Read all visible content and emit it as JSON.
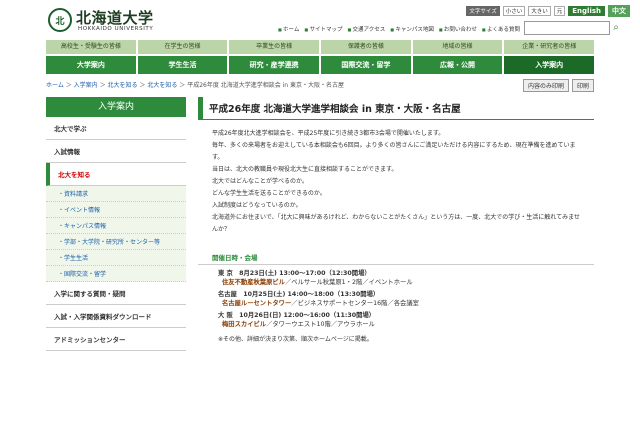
{
  "header": {
    "logo_mark": "北",
    "logo_ja": "北海道大学",
    "logo_en": "HOKKAIDO UNIVERSITY",
    "text_size_label": "文字サイズ",
    "sizes": [
      "小さい",
      "大きい",
      "元"
    ],
    "lang_en": "English",
    "lang_zh": "中文",
    "util_links": [
      "ホーム",
      "サイトマップ",
      "交通アクセス",
      "キャンパス地図",
      "お問い合わせ",
      "よくある質問"
    ],
    "search_placeholder": ""
  },
  "audience_tabs": [
    "高校生・受験生の皆様",
    "在学生の皆様",
    "卒業生の皆様",
    "保護者の皆様",
    "地域の皆様",
    "企業・研究者の皆様"
  ],
  "main_nav": [
    "大学案内",
    "学生生活",
    "研究・産学連携",
    "国際交流・留学",
    "広報・公開",
    "入学案内"
  ],
  "breadcrumb": [
    "ホーム",
    "入学案内",
    "北大を知る",
    "北大を知る",
    "平成26年度 北海道大学進学相談会 in 東京・大阪・名古屋"
  ],
  "print_buttons": [
    "内容のみ印刷",
    "印刷"
  ],
  "sidebar": {
    "head": "入学案内",
    "items": [
      "北大で学ぶ",
      "入試情報",
      "北大を知る"
    ],
    "subs": [
      "資料請求",
      "イベント情報",
      "キャンパス情報",
      "学部・大学院・研究所・センター等",
      "学生生活",
      "国際交流・留学"
    ],
    "items2": [
      "入学に関する質問・疑問",
      "入試・入学関係資料ダウンロード",
      "アドミッションセンター"
    ]
  },
  "main": {
    "title": "平成26年度 北海道大学進学相談会 in 東京・大阪・名古屋",
    "paragraphs": [
      "平成26年度北大進学相談会を、平成25年度に引き続き3都市3会場で開催いたします。",
      "毎年、多くの来場者をお迎えしている本相談会も6回目。より多くの皆さんにご満足いただける内容にするため、現在準備を進めています。",
      "当日は、北大の教職員や現役北大生に直接相談することができます。",
      "北大ではどんなことが学べるのか。",
      "どんな学生生活を送ることができるのか。",
      "入試制度はどうなっているのか。",
      "北海道外にお住まいで、「北大に興味があるけれど、わからないことがたくさん」という方は、一度、北大での学び・生活に触れてみませんか？"
    ],
    "schedule_heading": "開催日時・会場",
    "venues": [
      {
        "city": "東 京",
        "date": "8月23日(土) 13:00～17:00（12:30開場）",
        "place": "住友不動産秋葉原ビル",
        "detail": "／ベルサール秋葉原1・2階／イベントホール"
      },
      {
        "city": "名古屋",
        "date": "10月25日(土) 14:00～18:00（13:30開場）",
        "place": "名古屋ルーセントタワー",
        "detail": "／ビジネスサポートセンター16階／各会議室"
      },
      {
        "city": "大 阪",
        "date": "10月26日(日) 12:00～16:00（11:30開場）",
        "place": "梅田スカイビル",
        "detail": "／タワーウエスト10階／アウラホール"
      }
    ],
    "note": "※その他、詳細が決まり次第、順次ホームページに掲載。"
  }
}
